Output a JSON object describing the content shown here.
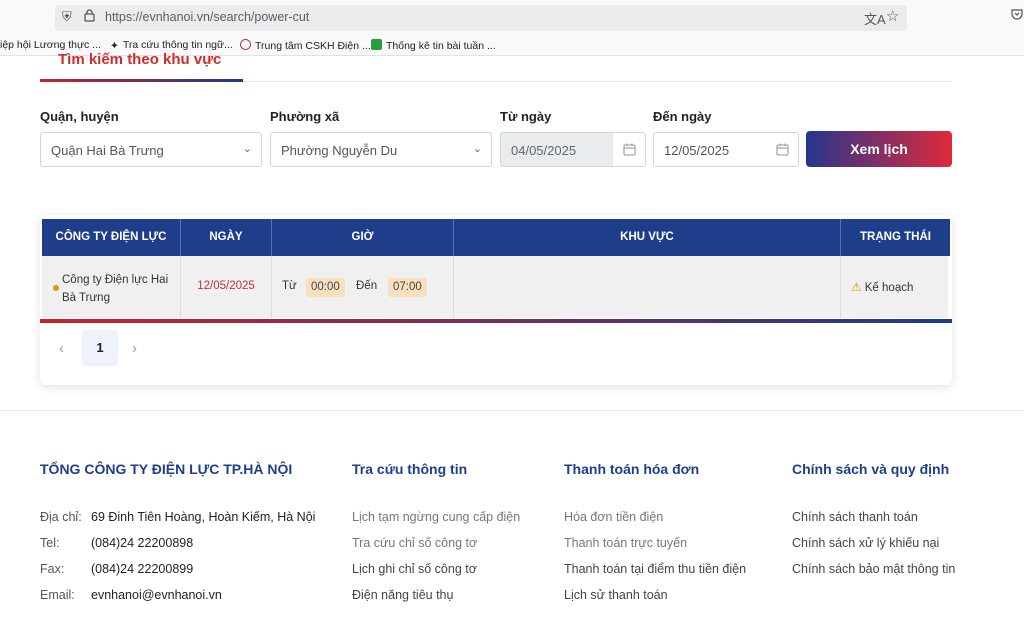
{
  "browser": {
    "url": "https://evnhanoi.vn/search/power-cut",
    "bookmarks": [
      "iệp hội Lương thực ...",
      "Tra cứu thông tin ngữ...",
      "Trung tâm CSKH Điện ...",
      "Thống kê tin bài tuần ..."
    ]
  },
  "tab": {
    "title": "Tìm kiếm theo khu vực"
  },
  "filters": {
    "district_label": "Quận, huyện",
    "district_value": "Quận Hai Bà Trưng",
    "ward_label": "Phường xã",
    "ward_value": "Phường Nguyễn Du",
    "from_label": "Từ ngày",
    "from_value": "04/05/2025",
    "to_label": "Đến ngày",
    "to_value": "12/05/2025",
    "view_button": "Xem lịch"
  },
  "table": {
    "headers": [
      "CÔNG TY ĐIỆN LỰC",
      "NGÀY",
      "GIỜ",
      "KHU VỰC",
      "TRẠNG THÁI"
    ],
    "rows": [
      {
        "company": "Công ty Điện lực Hai Bà Trưng",
        "date": "12/05/2025",
        "from_word": "Từ",
        "from_time": "00:00",
        "to_word": "Đến",
        "to_time": "07:00",
        "area": "",
        "status": "Kế hoạch"
      }
    ]
  },
  "pagination": {
    "current": "1"
  },
  "footer": {
    "company_title": "TỔNG CÔNG TY ĐIỆN LỰC TP.HÀ NỘI",
    "address_label": "Địa chỉ:",
    "address": "69 Đinh Tiên Hoàng, Hoàn Kiếm, Hà Nội",
    "tel_label": "Tel:",
    "tel": "(084)24 22200898",
    "fax_label": "Fax:",
    "fax": "(084)24 22200899",
    "email_label": "Email:",
    "email": "evnhanoi@evnhanoi.vn",
    "col2_title": "Tra cứu thông tin",
    "col2_links": [
      "Lịch tạm ngừng cung cấp điện",
      "Tra cứu chỉ số công tơ",
      "Lịch ghi chỉ số công tơ",
      "Điện năng tiêu thụ"
    ],
    "col3_title": "Thanh toán hóa đơn",
    "col3_links": [
      "Hóa đơn tiền điện",
      "Thanh toán trực tuyến",
      "Thanh toán tại điểm thu tiền điện",
      "Lịch sử thanh toán"
    ],
    "col4_title": "Chính sách và quy định",
    "col4_links": [
      "Chính sách thanh toán",
      "Chính sách xử lý khiếu nại",
      "Chính sách bảo mật thông tin"
    ]
  },
  "colors": {
    "primary": "#1e3e8c",
    "accent": "#d12a2a",
    "status": "#e59400"
  },
  "icons": [
    "shield-icon",
    "lock-icon",
    "translate-icon",
    "star-icon",
    "pocket-icon",
    "chevron-down-icon",
    "calendar-icon",
    "warning-icon",
    "chevron-left-icon",
    "chevron-right-icon"
  ]
}
